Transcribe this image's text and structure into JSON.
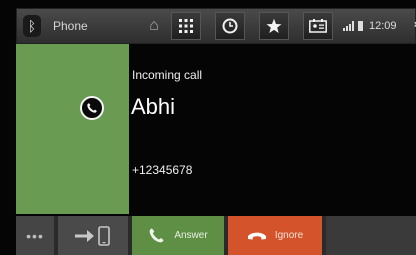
{
  "app": {
    "title": "Phone",
    "bluetooth_icon": "bluetooth-icon"
  },
  "toolbar": {
    "home_icon": "home-icon",
    "buttons": [
      {
        "name": "dialpad-button",
        "icon": "grid-icon"
      },
      {
        "name": "recents-button",
        "icon": "clock-icon"
      },
      {
        "name": "favorites-button",
        "icon": "star-icon"
      },
      {
        "name": "contacts-button",
        "icon": "contact-card-icon"
      }
    ]
  },
  "status": {
    "time": "12:09",
    "signal_icon": "signal-icon",
    "battery_icon": "battery-icon",
    "settings_icon": "settings-icon"
  },
  "call": {
    "status": "Incoming call",
    "caller_name": "Abhi",
    "caller_number": "+12345678",
    "panel_color": "#6a9b52"
  },
  "actions": {
    "more_label": "•••",
    "answer_label": "Answer",
    "ignore_label": "Ignore",
    "answer_color": "#5e8f45",
    "ignore_color": "#d4532a"
  }
}
